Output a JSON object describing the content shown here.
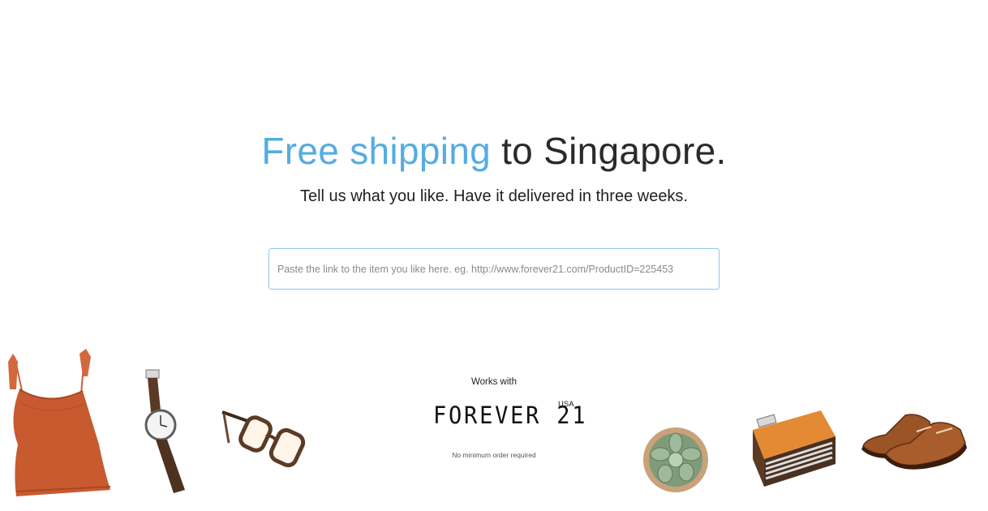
{
  "hero": {
    "headline_accent": "Free shipping",
    "headline_rest": " to Singapore.",
    "subheadline": "Tell us what you like. Have it delivered in three weeks."
  },
  "search": {
    "value": "",
    "placeholder": "Paste the link to the item you like here. eg. http://www.forever21.com/ProductID=225453"
  },
  "partners": {
    "works_with_label": "Works with",
    "brand_name": "FOREVER 21",
    "brand_country": "USA",
    "note": "No minimum order required"
  },
  "products": [
    {
      "icon": "tank-top-icon"
    },
    {
      "icon": "wristwatch-icon"
    },
    {
      "icon": "eyeglasses-icon"
    },
    {
      "icon": "succulent-plant-icon"
    },
    {
      "icon": "radio-icon"
    },
    {
      "icon": "dress-shoes-icon"
    }
  ],
  "colors": {
    "accent": "#55ace2",
    "text": "#2a2a2a",
    "input_border": "#8ec6ea"
  }
}
